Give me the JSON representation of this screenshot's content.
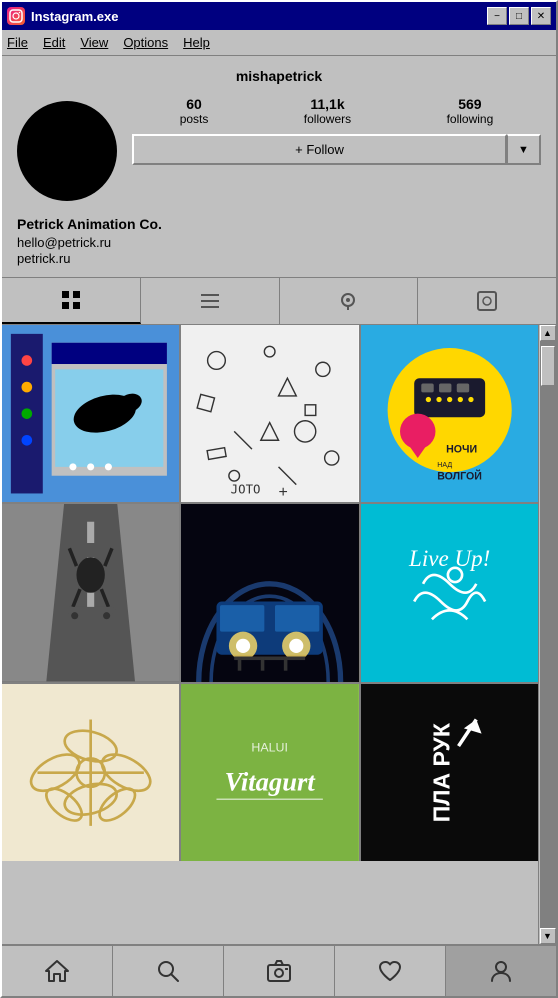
{
  "window": {
    "title": "Instagram.exe",
    "icon": "instagram-icon",
    "buttons": {
      "minimize": "−",
      "maximize": "□",
      "close": "✕"
    }
  },
  "menu": {
    "items": [
      "File",
      "Edit",
      "View",
      "Options",
      "Help"
    ]
  },
  "profile": {
    "username": "mishapetrick",
    "stats": {
      "posts": {
        "value": "60",
        "label": "posts"
      },
      "followers": {
        "value": "11,1k",
        "label": "followers"
      },
      "following": {
        "value": "569",
        "label": "following"
      }
    },
    "follow_button": "+ Follow",
    "dropdown_arrow": "▼",
    "bio_name": "Petrick Animation Co.",
    "bio_email": "hello@petrick.ru",
    "bio_website": "petrick.ru"
  },
  "tabs": {
    "items": [
      {
        "label": "⊞",
        "name": "grid-tab",
        "active": true
      },
      {
        "label": "≡",
        "name": "list-tab"
      },
      {
        "label": "◎",
        "name": "location-tab"
      },
      {
        "label": "⊡",
        "name": "tag-tab"
      }
    ]
  },
  "grid": {
    "cells": [
      {
        "id": 1,
        "type": "blue-window",
        "desc": "pixel art blue window"
      },
      {
        "id": 2,
        "type": "pattern",
        "desc": "doodle pattern"
      },
      {
        "id": 3,
        "type": "poster",
        "desc": "nochi nad volgoy poster"
      },
      {
        "id": 4,
        "type": "skate",
        "desc": "skate photo"
      },
      {
        "id": 5,
        "type": "metro",
        "desc": "metro dark photo"
      },
      {
        "id": 6,
        "type": "live",
        "desc": "live up teal"
      },
      {
        "id": 7,
        "type": "illustration",
        "desc": "beige illustration"
      },
      {
        "id": 8,
        "type": "vitagurt",
        "desc": "vitagurt green"
      },
      {
        "id": 9,
        "type": "ruk",
        "desc": "black text"
      }
    ]
  },
  "scrollbar": {
    "up_arrow": "▲",
    "down_arrow": "▼"
  },
  "bottom_nav": {
    "items": [
      {
        "label": "⌂",
        "name": "home-nav"
      },
      {
        "label": "🔍",
        "name": "search-nav"
      },
      {
        "label": "📷",
        "name": "camera-nav"
      },
      {
        "label": "♡",
        "name": "heart-nav"
      },
      {
        "label": "👤",
        "name": "profile-nav"
      }
    ]
  }
}
